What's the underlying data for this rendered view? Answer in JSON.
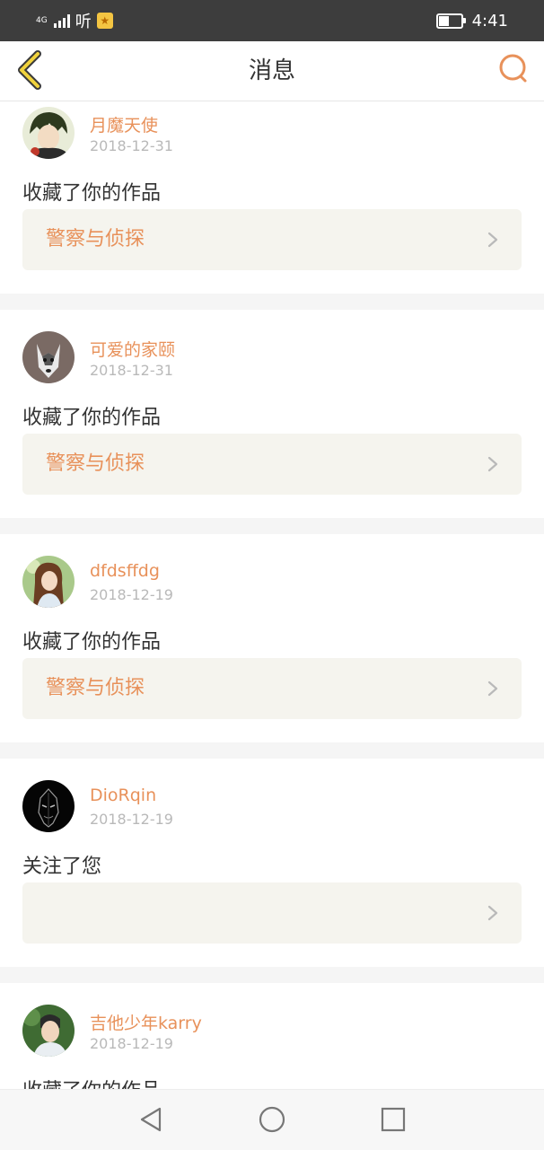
{
  "status_bar": {
    "network": "4G",
    "app_label": "听",
    "time": "4:41",
    "battery_level": 0.45
  },
  "header": {
    "title": "消息",
    "back_icon": "chevron-left-icon",
    "search_icon": "search-icon"
  },
  "messages": [
    {
      "user": "月魔天使",
      "date": "2018-12-31",
      "action": "收藏了你的作品",
      "work": "警察与侦探"
    },
    {
      "user": "可爱的家颐",
      "date": "2018-12-31",
      "action": "收藏了你的作品",
      "work": "警察与侦探"
    },
    {
      "user": "dfdsffdg",
      "date": "2018-12-19",
      "action": "收藏了你的作品",
      "work": "警察与侦探"
    },
    {
      "user": "DioRqin",
      "date": "2018-12-19",
      "action": "关注了您",
      "work": ""
    },
    {
      "user": "吉他少年karry",
      "date": "2018-12-19",
      "action": "收藏了你的作品",
      "work": ""
    }
  ],
  "nav_bar": {
    "back_icon": "triangle-back-icon",
    "home_icon": "circle-home-icon",
    "recents_icon": "square-recents-icon"
  },
  "colors": {
    "accent": "#e8915a",
    "status_bar": "#3d3d3d",
    "work_card_bg": "#f5f4ee"
  }
}
